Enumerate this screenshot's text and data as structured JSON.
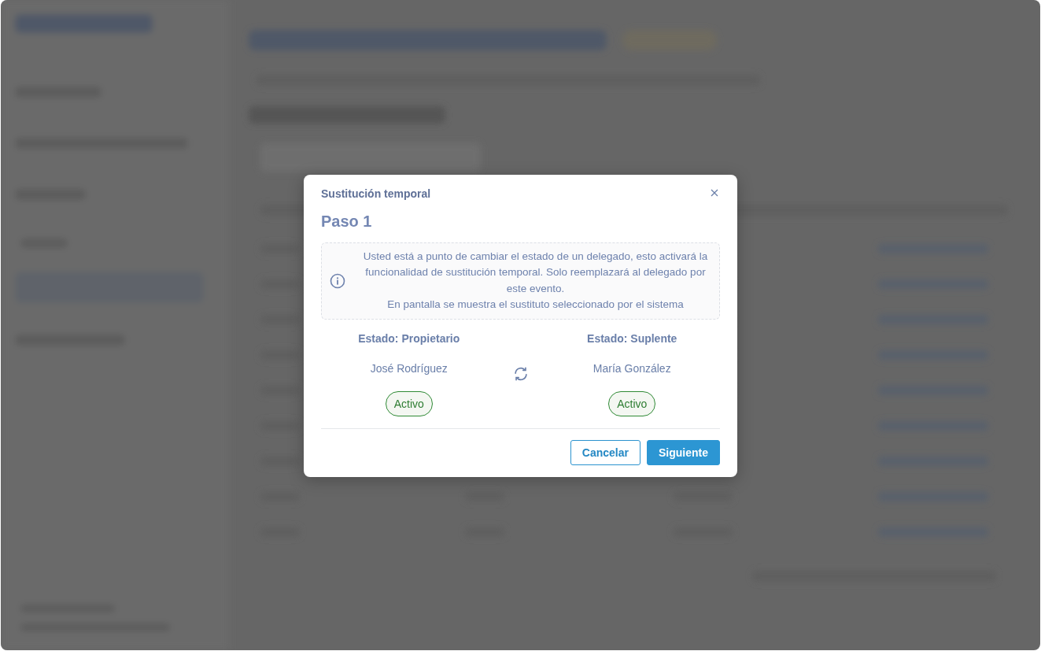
{
  "dialog": {
    "title": "Sustitución temporal",
    "step": "Paso 1",
    "info": "Usted está a punto de cambiar el estado de un delegado, esto activará la funcionalidad de sustitución temporal. Solo reemplazará al delegado por este evento.\nEn pantalla se muestra el sustituto seleccionado por el sistema",
    "people": [
      {
        "state": "Estado: Propietario",
        "name": "José Rodríguez",
        "status": "Activo"
      },
      {
        "state": "Estado: Suplente",
        "name": "María González",
        "status": "Activo"
      }
    ],
    "buttons": [
      {
        "label": "Cancelar",
        "kind": "secondary"
      },
      {
        "label": "Siguiente",
        "kind": "primary"
      }
    ]
  }
}
